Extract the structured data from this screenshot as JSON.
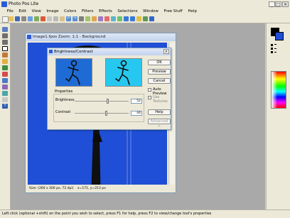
{
  "app": {
    "title": "Photo Pos Lite",
    "minimize": "_",
    "maximize": "□",
    "close": "×"
  },
  "menu": [
    "File",
    "Edit",
    "View",
    "Image",
    "Colors",
    "Filters",
    "Effects",
    "Selections",
    "Window",
    "Free Stuff",
    "Help"
  ],
  "document": {
    "title": "Image1.fpos  Zoom: 1:1 - Background",
    "status_size": "Size: (260 x 300 px, 72 dpi)",
    "status_pos": "x=171, y=213 px"
  },
  "dialog": {
    "title": "Brightness/Contrast",
    "close": "×",
    "properties_label": "Properties",
    "brightness_label": "Brightness",
    "brightness_value": "52",
    "contrast_label": "Contrast",
    "contrast_value": "44",
    "buttons": {
      "ok": "OK",
      "preview": "Preview",
      "cancel": "Cancel",
      "help": "Help",
      "advanced": "Advanced >"
    },
    "auto_preview_label": "Auto Preview",
    "use_textures_label": "Use Textures"
  },
  "status_bar": "Left click (optional +shift) on the point you wish to select, press F1 for help, press F2 to view/change tool's properties",
  "colors": {
    "canvas_blue": "#1f4fd6",
    "preview_blue": "#1f6bd6",
    "preview_cyan": "#27c8f0",
    "figure": "#101010"
  }
}
